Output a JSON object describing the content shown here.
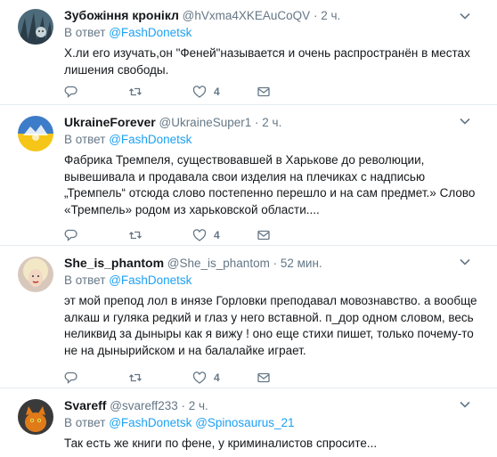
{
  "colors": {
    "link": "#1da1f2",
    "secondary": "#657786",
    "text": "#14171a",
    "divider": "#e6ecf0"
  },
  "tweets": [
    {
      "name": "Зубожіння кронікл",
      "handle": "@hVxma4XKEAuCoQV",
      "dot": "·",
      "time": "2 ч.",
      "reply_prefix": "В ответ",
      "reply_to": [
        "@FashDonetsk"
      ],
      "text": "Х.ли его изучать,он \"Феней\"называется и очень распространён в местах лишения свободы.",
      "likes": "4"
    },
    {
      "name": "UkraineForever",
      "handle": "@UkraineSuper1",
      "dot": "·",
      "time": "2 ч.",
      "reply_prefix": "В ответ",
      "reply_to": [
        "@FashDonetsk"
      ],
      "text": "Фабрика Тремпеля,  существовавшей в Харькове до революции, вывешивала и продавала свои изделия на плечиках с надписью „Тремпель“ отсюда слово постепенно перешло и на сам предмет.»  Слово «Тремпель» родом из харьковской области....",
      "likes": "4"
    },
    {
      "name": "She_is_phantom",
      "handle": "@She_is_phantom",
      "dot": "·",
      "time": "52 мин.",
      "reply_prefix": "В ответ",
      "reply_to": [
        "@FashDonetsk"
      ],
      "text": "эт мой препод лол в инязе Горловки преподавал мовознавство. а вообще алкаш и гуляка редкий и глаз у него вставной. п_дор одном словом, весь неликвид за дыныры как я вижу ! оно еще стихи пишет, только почему-то не на дынырийском и на балалайке играет.",
      "likes": "4"
    },
    {
      "name": "Svareff",
      "handle": "@svareff233",
      "dot": "·",
      "time": "2 ч.",
      "reply_prefix": "В ответ",
      "reply_to": [
        "@FashDonetsk",
        "@Spinosaurus_21"
      ],
      "text": "Так есть же книги по фене, у криминалистов спросите..."
    }
  ],
  "icons": {
    "reply": "reply-icon",
    "retweet": "retweet-icon",
    "like": "heart-icon",
    "dm": "envelope-icon",
    "caret": "chevron-down-icon"
  }
}
